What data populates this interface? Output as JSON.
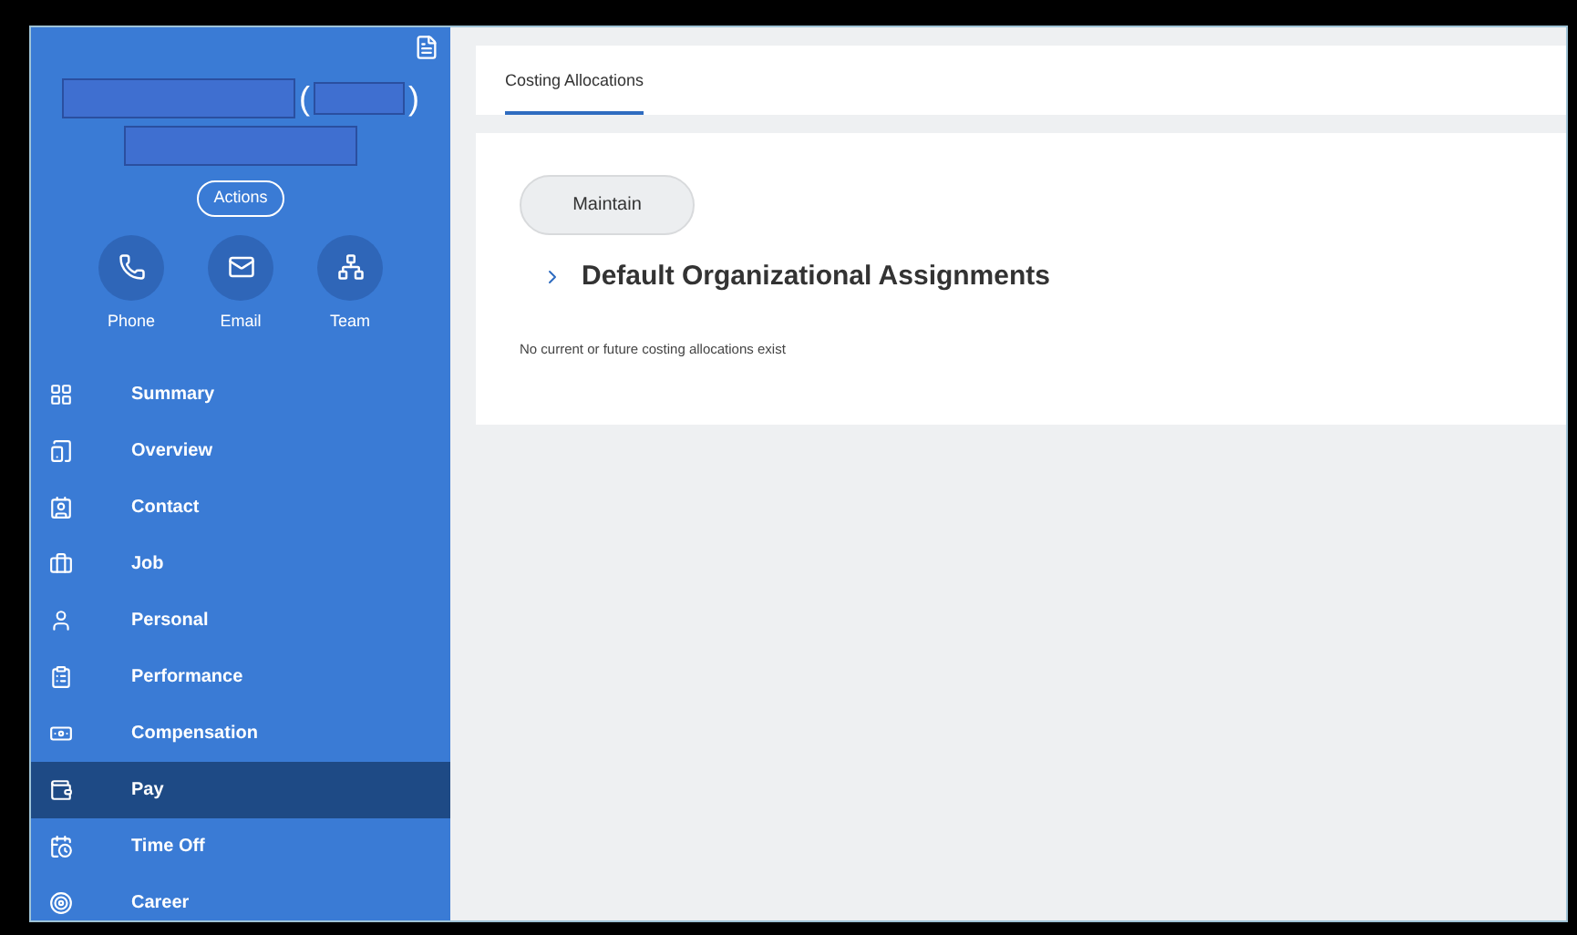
{
  "header": {
    "open_paren": "(",
    "close_paren": ")",
    "actions_button": "Actions"
  },
  "quick_actions": [
    {
      "label": "Phone"
    },
    {
      "label": "Email"
    },
    {
      "label": "Team"
    }
  ],
  "sidebar": {
    "items": [
      {
        "label": "Summary",
        "selected": false
      },
      {
        "label": "Overview",
        "selected": false
      },
      {
        "label": "Contact",
        "selected": false
      },
      {
        "label": "Job",
        "selected": false
      },
      {
        "label": "Personal",
        "selected": false
      },
      {
        "label": "Performance",
        "selected": false
      },
      {
        "label": "Compensation",
        "selected": false
      },
      {
        "label": "Pay",
        "selected": true
      },
      {
        "label": "Time Off",
        "selected": false
      },
      {
        "label": "Career",
        "selected": false
      }
    ]
  },
  "tabs": [
    {
      "label": "Costing Allocations",
      "selected": true
    }
  ],
  "maintain_button": "Maintain",
  "section": {
    "title": "Default Organizational Assignments",
    "expanded": false
  },
  "message": "No current or future costing allocations exist"
}
